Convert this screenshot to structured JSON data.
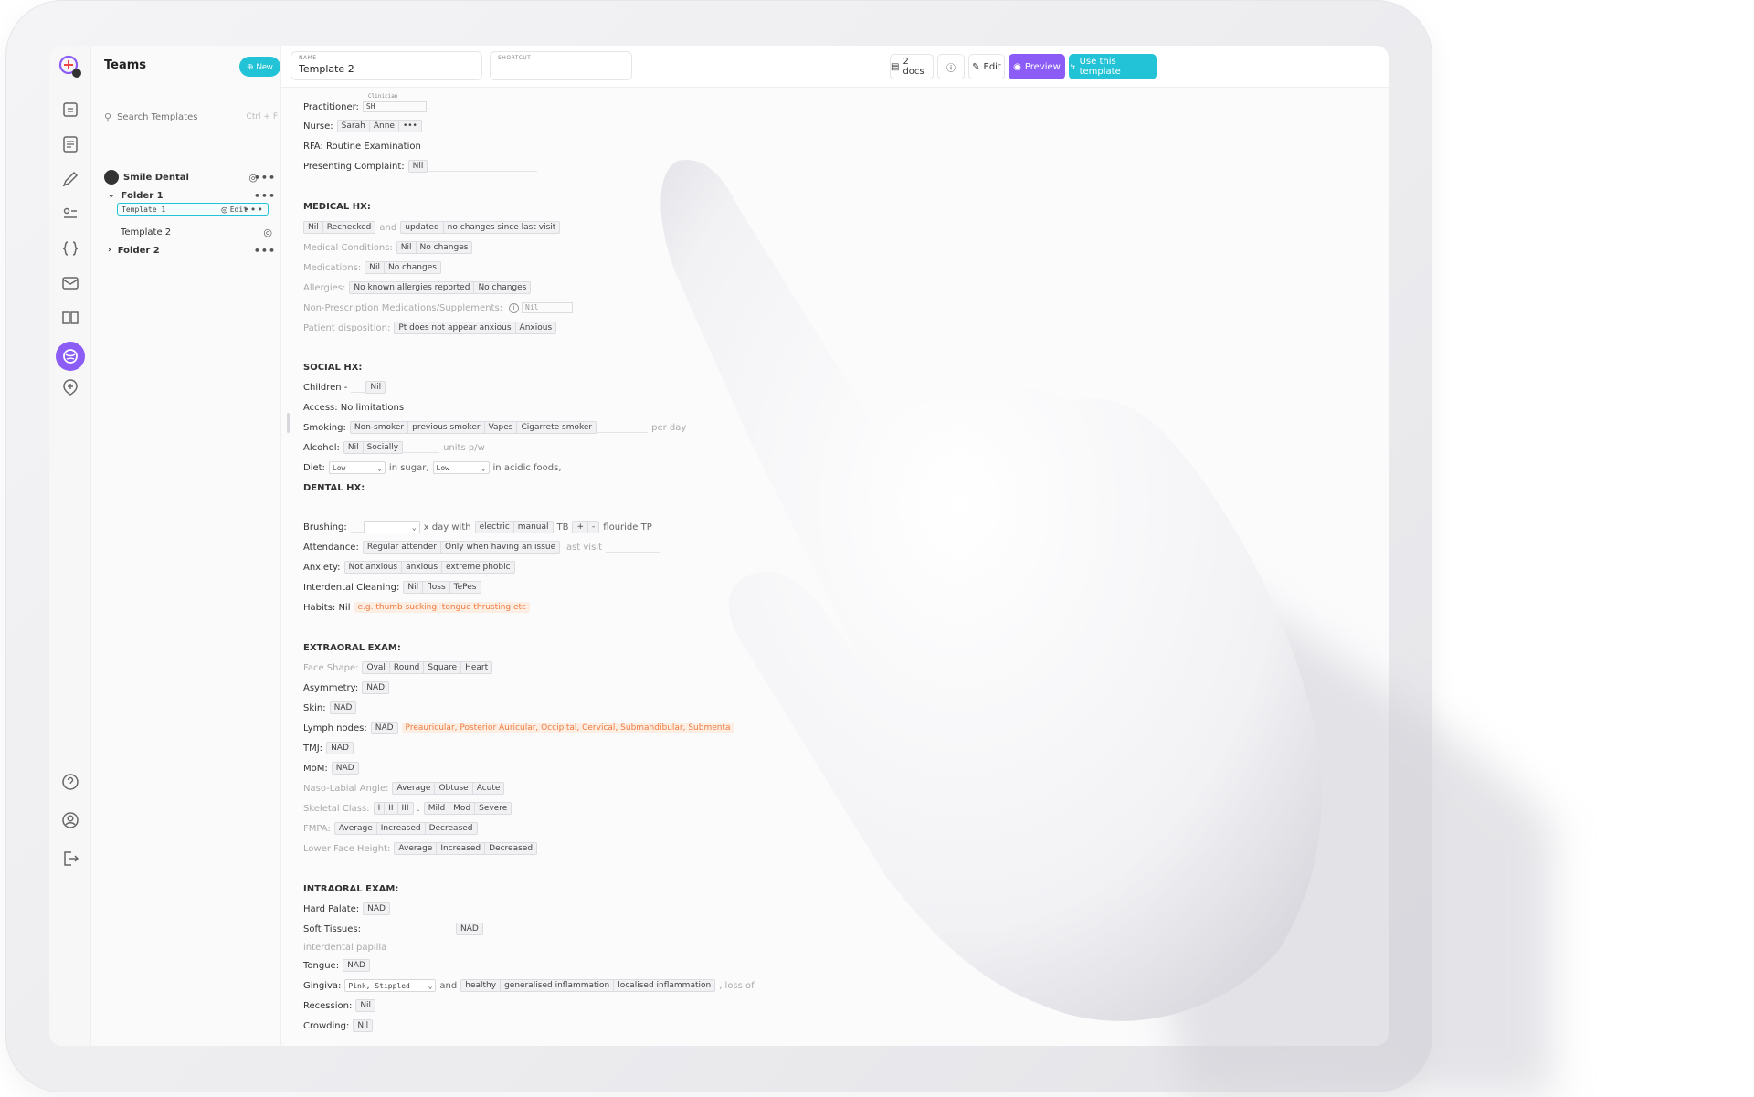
{
  "colors": {
    "accent_teal": "#22c3d6",
    "accent_purple": "#8b5cf6",
    "warning": "#f07a3e"
  },
  "rail": {
    "icons": [
      "home-icon",
      "document-icon",
      "pen-icon",
      "list-icon",
      "braces-icon",
      "mail-icon",
      "book-icon",
      "templates-icon",
      "plus-circle-icon",
      "help-icon",
      "user-circle-icon",
      "logout-icon"
    ]
  },
  "sidebar": {
    "title": "Teams",
    "new_label": "New",
    "search_placeholder": "Search Templates",
    "search_shortcut": "Ctrl + F",
    "org": "Smile Dental",
    "folder1": "Folder 1",
    "template1": "Template 1",
    "template1_edit": "Edit",
    "template2": "Template 2",
    "folder2": "Folder 2"
  },
  "topbar": {
    "name_label": "NAME",
    "name_value": "Template 2",
    "shortcut_label": "SHORTCUT",
    "shortcut_value": "",
    "docs": "2 docs",
    "edit": "Edit",
    "preview": "Preview",
    "use": "Use this template"
  },
  "doc": {
    "practitioner": {
      "label": "Practitioner:",
      "hint": "Clinician",
      "value": "SH"
    },
    "nurse": {
      "label": "Nurse:",
      "options": [
        "Sarah",
        "Anne",
        "•••"
      ]
    },
    "rfa": "RFA: Routine Examination",
    "complaint": {
      "label": "Presenting Complaint:",
      "options": [
        "Nil"
      ]
    },
    "medical": {
      "heading": "MEDICAL HX:",
      "row1": {
        "a": [
          "Nil",
          "Rechecked"
        ],
        "and": "and",
        "b": [
          "updated",
          "no changes since last visit"
        ]
      },
      "conditions": {
        "label": "Medical Conditions:",
        "options": [
          "Nil",
          "No changes"
        ]
      },
      "medications": {
        "label": "Medications:",
        "options": [
          "Nil",
          "No changes"
        ]
      },
      "allergies": {
        "label": "Allergies:",
        "options": [
          "No known allergies reported",
          "No changes"
        ]
      },
      "nonpres": {
        "label": "Non-Prescription Medications/Supplements:",
        "value": "Nil"
      },
      "disposition": {
        "label": "Patient disposition:",
        "options": [
          "Pt does not appear anxious",
          "Anxious"
        ]
      }
    },
    "social": {
      "heading": "SOCIAL HX:",
      "children": {
        "label": "Children -",
        "options": [
          "Nil"
        ]
      },
      "access": "Access: No limitations",
      "smoking": {
        "label": "Smoking:",
        "options": [
          "Non-smoker",
          "previous smoker",
          "Vapes",
          "Cigarrete smoker"
        ],
        "suffix": "per day"
      },
      "alcohol": {
        "label": "Alcohol:",
        "options": [
          "Nil",
          "Socially"
        ],
        "suffix": "units p/w"
      },
      "diet": {
        "label": "Diet:",
        "sel1": "Low",
        "mid": "in sugar,",
        "sel2": "Low",
        "suffix": "in acidic foods,"
      }
    },
    "dental": {
      "heading": "DENTAL HX:",
      "brushing": {
        "label": "Brushing:",
        "mid": "x day with",
        "options": [
          "electric",
          "manual"
        ],
        "tb": "TB",
        "pm": [
          "+",
          "-"
        ],
        "suffix": "flouride TP"
      },
      "attendance": {
        "label": "Attendance:",
        "options": [
          "Regular attender",
          "Only when having an issue"
        ],
        "suffix": "last visit"
      },
      "anxiety": {
        "label": "Anxiety:",
        "options": [
          "Not anxious",
          "anxious",
          "extreme phobic"
        ]
      },
      "interdental": {
        "label": "Interdental Cleaning:",
        "options": [
          "Nil",
          "floss",
          "TePes"
        ]
      },
      "habits": {
        "label": "Habits: Nil",
        "placeholder": "e.g. thumb sucking, tongue thrusting etc"
      }
    },
    "extraoral": {
      "heading": "EXTRAORAL EXAM:",
      "face": {
        "label": "Face Shape:",
        "options": [
          "Oval",
          "Round",
          "Square",
          "Heart"
        ]
      },
      "asym": {
        "label": "Asymmetry:",
        "options": [
          "NAD"
        ]
      },
      "skin": {
        "label": "Skin:",
        "options": [
          "NAD"
        ]
      },
      "lymph": {
        "label": "Lymph nodes:",
        "options": [
          "NAD"
        ],
        "warning": "Preauricular, Posterior Auricular, Occipital, Cervical, Submandibular, Submenta"
      },
      "tmj": {
        "label": "TMJ:",
        "options": [
          "NAD"
        ]
      },
      "mom": {
        "label": "MoM:",
        "options": [
          "NAD"
        ]
      },
      "naso": {
        "label": "Naso-Labial Angle:",
        "options": [
          "Average",
          "Obtuse",
          "Acute"
        ]
      },
      "skeletal": {
        "label": "Skeletal Class:",
        "a": [
          "I",
          "II",
          "III"
        ],
        "sep": ".",
        "b": [
          "Mild",
          "Mod",
          "Severe"
        ]
      },
      "fmpa": {
        "label": "FMPA:",
        "options": [
          "Average",
          "Increased",
          "Decreased"
        ]
      },
      "lfh": {
        "label": "Lower Face Height:",
        "options": [
          "Average",
          "Increased",
          "Decreased"
        ]
      }
    },
    "intraoral": {
      "heading": "INTRAORAL EXAM:",
      "hard": {
        "label": "Hard Palate:",
        "options": [
          "NAD"
        ]
      },
      "soft": {
        "label": "Soft Tissues:",
        "options": [
          "NAD"
        ]
      },
      "papilla": "interdental papilla",
      "tongue": {
        "label": "Tongue:",
        "options": [
          "NAD"
        ]
      },
      "gingiva": {
        "label": "Gingiva:",
        "sel": "Pink, Stippled",
        "and": "and",
        "options": [
          "healthy",
          "generalised inflammation",
          "localised inflammation"
        ],
        "suffix": ", loss of"
      },
      "recession": {
        "label": "Recession:",
        "options": [
          "Nil"
        ]
      },
      "crowding": {
        "label": "Crowding:",
        "options": [
          "Nil"
        ]
      }
    }
  }
}
